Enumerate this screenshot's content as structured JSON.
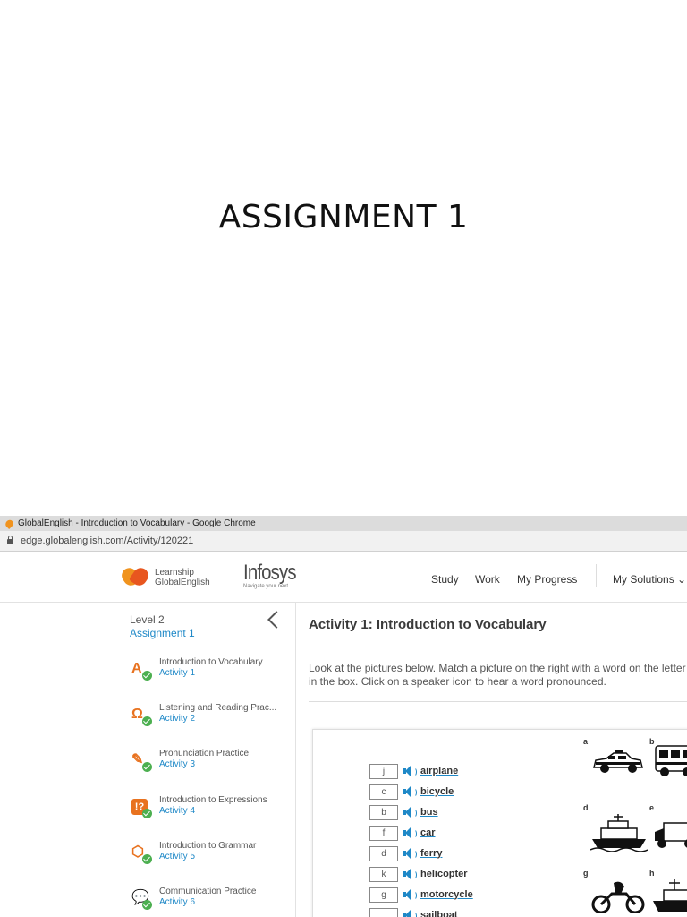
{
  "slide": {
    "title": "ASSIGNMENT 1"
  },
  "browser": {
    "window_title": "GlobalEnglish - Introduction to Vocabulary - Google Chrome",
    "url": "edge.globalenglish.com/Activity/120221"
  },
  "header": {
    "brand_line1": "Learnship",
    "brand_line2": "GlobalEnglish",
    "partner_name": "Infosys",
    "partner_tagline": "Navigate your next",
    "nav": [
      "Study",
      "Work",
      "My Progress",
      "My Solutions"
    ]
  },
  "sidebar": {
    "level": "Level 2",
    "assignment": "Assignment 1",
    "activities": [
      {
        "title": "Introduction to Vocabulary",
        "sub": "Activity 1",
        "icon": "vocabulary-icon"
      },
      {
        "title": "Listening and Reading Prac...",
        "sub": "Activity 2",
        "icon": "headphones-icon"
      },
      {
        "title": "Pronunciation Practice",
        "sub": "Activity 3",
        "icon": "microphone-icon"
      },
      {
        "title": "Introduction to Expressions",
        "sub": "Activity 4",
        "icon": "expression-icon"
      },
      {
        "title": "Introduction to Grammar",
        "sub": "Activity 5",
        "icon": "grammar-cube-icon"
      },
      {
        "title": "Communication Practice",
        "sub": "Activity 6",
        "icon": "speech-bubble-icon"
      }
    ]
  },
  "content": {
    "heading": "Activity 1: Introduction to Vocabulary",
    "instructions": "Look at the pictures below. Match a picture on the right with a word on the letter in the box. Click on a speaker icon to hear a word pronounced.",
    "words": [
      {
        "letter": "j",
        "word": "airplane"
      },
      {
        "letter": "c",
        "word": "bicycle"
      },
      {
        "letter": "b",
        "word": "bus"
      },
      {
        "letter": "f",
        "word": "car"
      },
      {
        "letter": "d",
        "word": "ferry"
      },
      {
        "letter": "k",
        "word": "helicopter"
      },
      {
        "letter": "g",
        "word": "motorcycle"
      },
      {
        "letter": "",
        "word": "sailboat"
      }
    ],
    "picture_labels": [
      "a",
      "b",
      "d",
      "e",
      "g",
      "h"
    ]
  },
  "colors": {
    "accent": "#1e88c7",
    "brand_orange": "#f0931e",
    "check_green": "#4caf50"
  }
}
